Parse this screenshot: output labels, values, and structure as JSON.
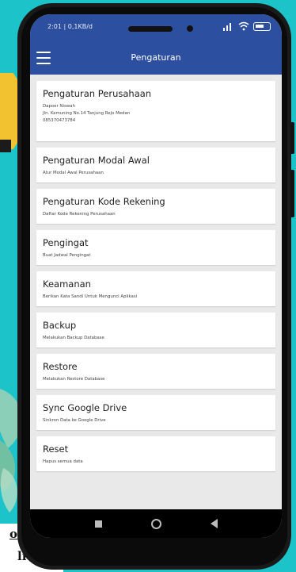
{
  "status": {
    "time": "2:01 | 0,1KB/d"
  },
  "appbar": {
    "title": "Pengaturan"
  },
  "settings": [
    {
      "title": "Pengaturan Perusahaan",
      "lines": [
        "Dapoer Niswah",
        "Jln. Kemuning No.14 Tanjung Rejo Medan",
        "085370473784"
      ]
    },
    {
      "title": "Pengaturan Modal Awal",
      "lines": [
        "Atur Modal Awal Perusahaan"
      ]
    },
    {
      "title": "Pengaturan Kode Rekening",
      "lines": [
        "Daftar Kode Rekening Perusahaan"
      ]
    },
    {
      "title": "Pengingat",
      "lines": [
        "Buat Jadwal Pengingat"
      ]
    },
    {
      "title": "Keamanan",
      "lines": [
        "Berikan Kata Sandi Untuk Mengunci Aplikasi"
      ]
    },
    {
      "title": "Backup",
      "lines": [
        "Melakukan Backup Database"
      ]
    },
    {
      "title": "Restore",
      "lines": [
        "Melakukan Restore Database"
      ]
    },
    {
      "title": "Sync Google Drive",
      "lines": [
        "Sinkron Data ke Google Drive"
      ]
    },
    {
      "title": "Reset",
      "lines": [
        "Hapus semua data"
      ]
    }
  ],
  "background": {
    "text1": "ofi",
    "text2": "lit"
  },
  "colors": {
    "appbar": "#2d4fa0",
    "background": "#1cc4c9",
    "arrow": "#f2c230"
  },
  "icons": {
    "menu": "hamburger-menu-icon",
    "signal": "signal-icon",
    "wifi": "wifi-icon",
    "battery": "battery-icon"
  }
}
